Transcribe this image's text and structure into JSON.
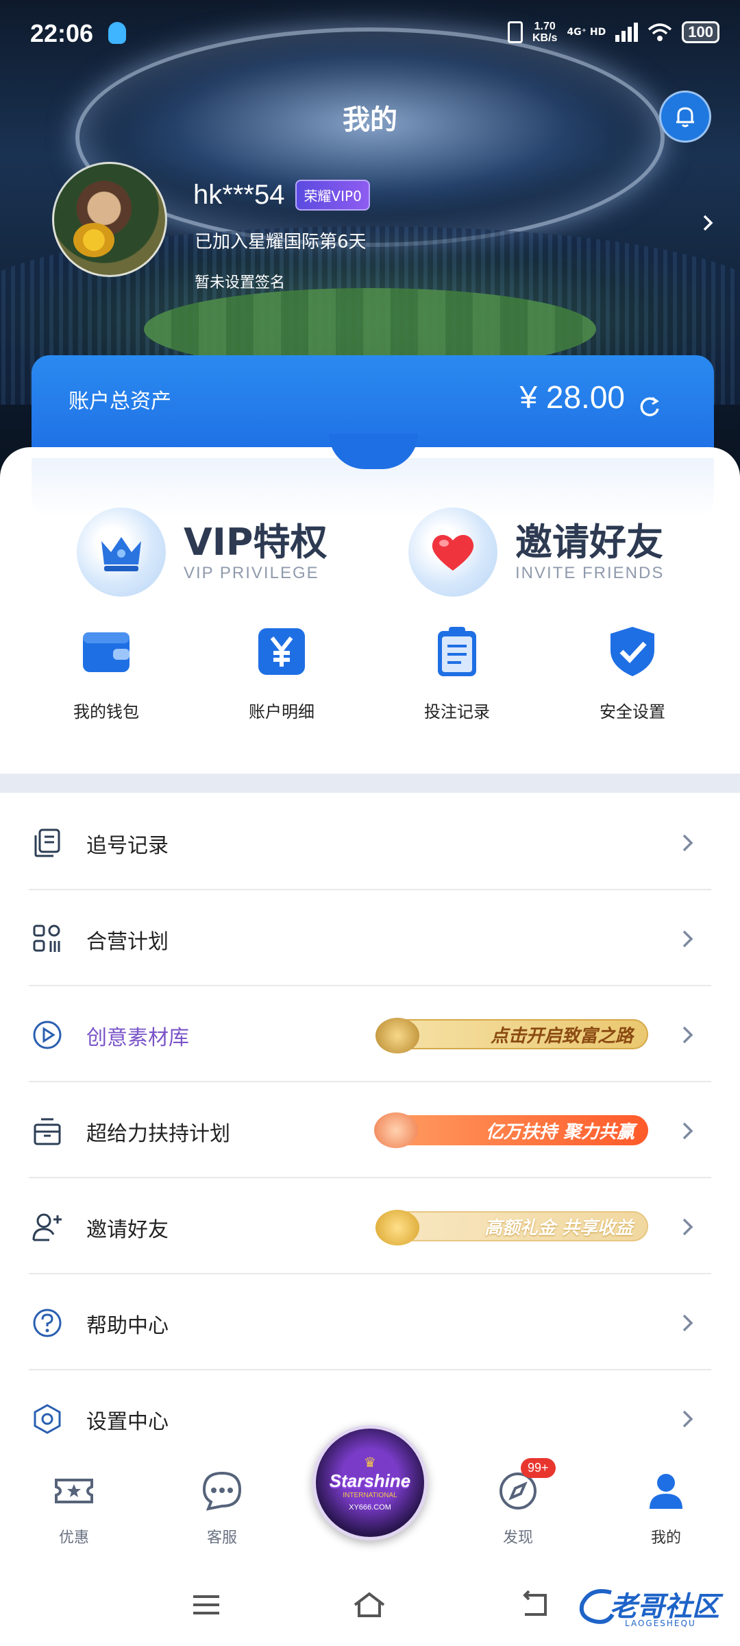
{
  "status_bar": {
    "time": "22:06",
    "net_speed": "1.70",
    "net_speed_unit": "KB/s",
    "network": "4G⁺ HD",
    "battery": "100"
  },
  "header": {
    "title": "我的",
    "bell_icon": "bell-icon"
  },
  "profile": {
    "username": "hk***54",
    "vip_badge": "荣耀VIP0",
    "joined_text": "已加入星耀国际第6天",
    "signature": "暂未设置签名"
  },
  "balance": {
    "label": "账户总资产",
    "value": "¥ 28.00"
  },
  "promos": [
    {
      "title": "VIP特权",
      "subtitle": "VIP PRIVILEGE",
      "icon": "crown-icon"
    },
    {
      "title": "邀请好友",
      "subtitle": "INVITE FRIENDS",
      "icon": "heart-icon"
    }
  ],
  "quick_actions": [
    {
      "label": "我的钱包",
      "icon": "wallet-icon"
    },
    {
      "label": "账户明细",
      "icon": "yen-icon"
    },
    {
      "label": "投注记录",
      "icon": "clipboard-icon"
    },
    {
      "label": "安全设置",
      "icon": "shield-check-icon"
    }
  ],
  "menu": [
    {
      "label": "追号记录",
      "icon": "records-icon"
    },
    {
      "label": "合营计划",
      "icon": "grid-icon"
    },
    {
      "label": "创意素材库",
      "icon": "play-circle-icon",
      "banner": "点击开启致富之路"
    },
    {
      "label": "超给力扶持计划",
      "icon": "gift-box-icon",
      "banner": "亿万扶持 聚力共赢"
    },
    {
      "label": "邀请好友",
      "icon": "add-user-icon",
      "banner": "高额礼金 共享收益"
    },
    {
      "label": "帮助中心",
      "icon": "help-circle-icon"
    },
    {
      "label": "设置中心",
      "icon": "settings-hex-icon"
    }
  ],
  "bottom_nav": [
    {
      "label": "优惠",
      "icon": "ticket-star-icon"
    },
    {
      "label": "客服",
      "icon": "chat-bubble-icon"
    },
    {
      "label": "发现",
      "icon": "compass-icon",
      "badge": "99+"
    },
    {
      "label": "我的",
      "icon": "user-icon"
    }
  ],
  "center_logo": {
    "text": "Starshine",
    "sub": "INTERNATIONAL",
    "site": "XY666.COM"
  },
  "watermark": {
    "text": "老哥社区",
    "sub": "LAOGESHEQU"
  },
  "colors": {
    "brand_blue": "#1f6fe4",
    "menu_accent_purple": "#7a54c8",
    "badge_red": "#e8362f"
  }
}
